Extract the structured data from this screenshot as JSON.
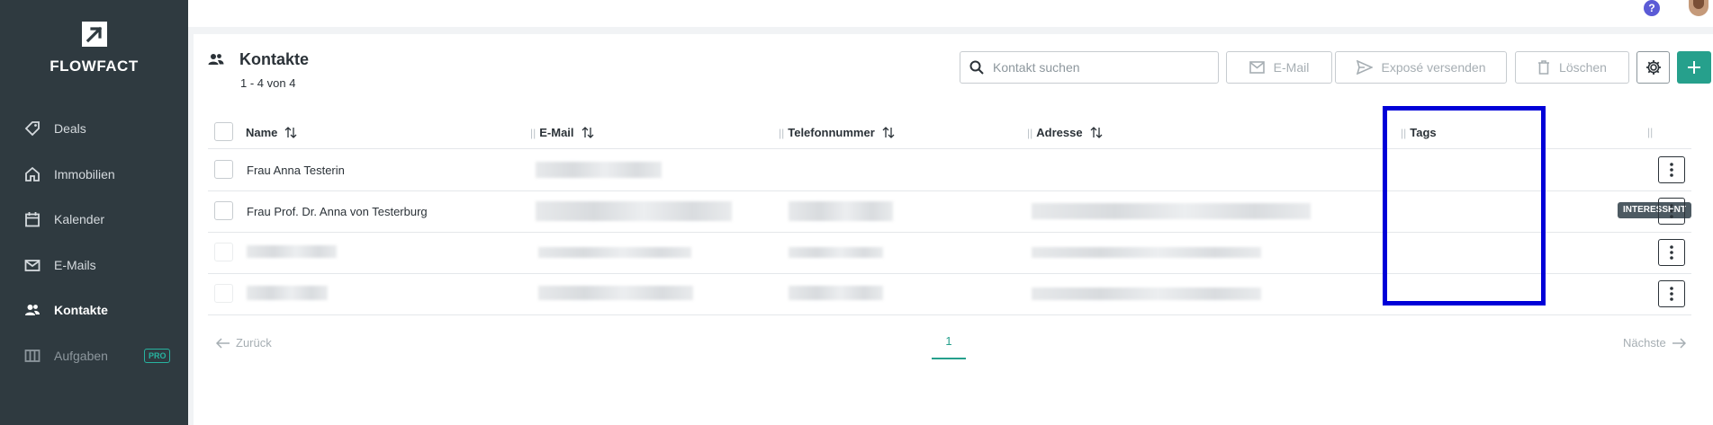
{
  "brand": {
    "name": "FLOWFACT"
  },
  "sidebar": {
    "items": [
      {
        "label": "Deals",
        "icon": "tag-icon"
      },
      {
        "label": "Immobilien",
        "icon": "home-icon"
      },
      {
        "label": "Kalender",
        "icon": "calendar-icon"
      },
      {
        "label": "E-Mails",
        "icon": "mail-icon"
      },
      {
        "label": "Kontakte",
        "icon": "contacts-icon",
        "active": true
      },
      {
        "label": "Aufgaben",
        "icon": "tasks-icon",
        "badge": "PRO"
      }
    ]
  },
  "header": {
    "help": "?"
  },
  "page": {
    "title": "Kontakte",
    "subtitle": "1 - 4 von 4"
  },
  "toolbar": {
    "search_placeholder": "Kontakt suchen",
    "email_label": "E-Mail",
    "expose_label": "Exposé versenden",
    "delete_label": "Löschen"
  },
  "table": {
    "columns": [
      "Name",
      "E-Mail",
      "Telefonnummer",
      "Adresse",
      "Tags"
    ],
    "rows": [
      {
        "name": "Frau Anna Testerin",
        "tag": ""
      },
      {
        "name": "Frau Prof. Dr. Anna von Testerburg",
        "tag": "INTERESSENT"
      },
      {
        "name": "",
        "tag": ""
      },
      {
        "name": "",
        "tag": ""
      }
    ]
  },
  "pagination": {
    "prev": "Zurück",
    "current": "1",
    "next": "Nächste"
  },
  "colors": {
    "sidebar": "#2f3a40",
    "accent": "#26a08c",
    "highlight": "#0000d8",
    "tag": "#4d5a62"
  }
}
